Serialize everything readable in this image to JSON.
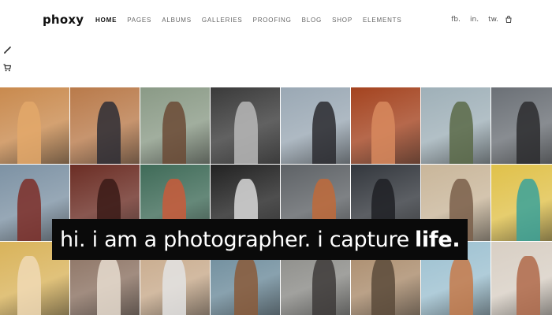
{
  "brand": {
    "logo": "phoxy"
  },
  "nav": [
    {
      "label": "HOME",
      "active": true
    },
    {
      "label": "PAGES",
      "active": false
    },
    {
      "label": "ALBUMS",
      "active": false
    },
    {
      "label": "GALLERIES",
      "active": false
    },
    {
      "label": "PROOFING",
      "active": false
    },
    {
      "label": "BLOG",
      "active": false
    },
    {
      "label": "SHOP",
      "active": false
    },
    {
      "label": "ELEMENTS",
      "active": false
    }
  ],
  "social": {
    "facebook": "fb.",
    "instagram": "in.",
    "twitter": "tw."
  },
  "icons": {
    "bag": "shopping-bag-icon",
    "brush": "paintbrush-icon",
    "cart": "cart-icon"
  },
  "hero": {
    "tagline_lead": "hi. i am a photographer. i capture",
    "tagline_emphasis": "life."
  },
  "gallery": {
    "tiles": [
      {
        "bg": "#c98a4e",
        "fig": "#e3a86a"
      },
      {
        "bg": "#b97a4a",
        "fig": "#2d2d35"
      },
      {
        "bg": "#8a9a86",
        "fig": "#6b4a35"
      },
      {
        "bg": "#3a3a3a",
        "fig": "#b9b9b9"
      },
      {
        "bg": "#9aa8b4",
        "fig": "#2a2a2f"
      },
      {
        "bg": "#a4431f",
        "fig": "#d88a5e"
      },
      {
        "bg": "#9fb0b8",
        "fig": "#5a6a48"
      },
      {
        "bg": "#6b7076",
        "fig": "#2b2b2e"
      },
      {
        "bg": "#7d92a4",
        "fig": "#7c2e28"
      },
      {
        "bg": "#6b2d24",
        "fig": "#3a1a16"
      },
      {
        "bg": "#3f6b58",
        "fig": "#c95a3a"
      },
      {
        "bg": "#222222",
        "fig": "#d8d8d8"
      },
      {
        "bg": "#5e6266",
        "fig": "#c06a3a"
      },
      {
        "bg": "#33373d",
        "fig": "#1f2024"
      },
      {
        "bg": "#c9b69a",
        "fig": "#7a5f4a"
      },
      {
        "bg": "#e0c14a",
        "fig": "#3aa29a"
      },
      {
        "bg": "#d9b35a",
        "fig": "#f0d9b5"
      },
      {
        "bg": "#8a7060",
        "fig": "#e6dccf"
      },
      {
        "bg": "#c7a98a",
        "fig": "#e3e3e3"
      },
      {
        "bg": "#6b8a9a",
        "fig": "#8a5a3a"
      },
      {
        "bg": "#8a8a86",
        "fig": "#3d3a38"
      },
      {
        "bg": "#a98a6a",
        "fig": "#5a4a3a"
      },
      {
        "bg": "#9cc0d0",
        "fig": "#c67a4a"
      },
      {
        "bg": "#d8cfc4",
        "fig": "#b06a4a"
      }
    ]
  }
}
